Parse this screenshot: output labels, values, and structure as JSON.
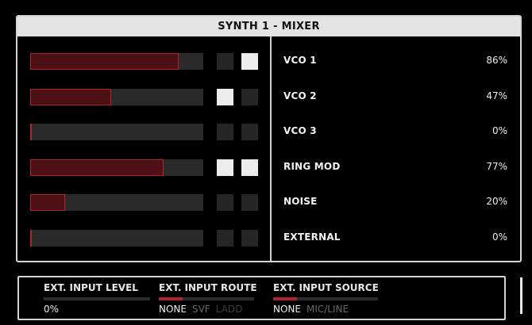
{
  "mixer": {
    "title": "SYNTH 1 - MIXER",
    "channels": [
      {
        "name": "VCO 1",
        "value": "86%",
        "level": 0.86,
        "toggles": [
          false,
          true
        ]
      },
      {
        "name": "VCO 2",
        "value": "47%",
        "level": 0.47,
        "toggles": [
          true,
          false
        ]
      },
      {
        "name": "VCO 3",
        "value": "0%",
        "level": 0.0,
        "toggles": [
          false,
          false
        ]
      },
      {
        "name": "RING MOD",
        "value": "77%",
        "level": 0.77,
        "toggles": [
          true,
          true
        ]
      },
      {
        "name": "NOISE",
        "value": "20%",
        "level": 0.2,
        "toggles": [
          false,
          false
        ]
      },
      {
        "name": "EXTERNAL",
        "value": "0%",
        "level": 0.0,
        "toggles": [
          false,
          false
        ]
      }
    ]
  },
  "ext": {
    "input_level": {
      "label": "EXT. INPUT LEVEL",
      "value": "0%"
    },
    "input_route": {
      "label": "EXT. INPUT ROUTE",
      "options": [
        "NONE",
        "SVF",
        "LADD"
      ],
      "selected": "NONE"
    },
    "input_source": {
      "label": "EXT. INPUT SOURCE",
      "options": [
        "NONE",
        "MIC/LINE"
      ],
      "selected": "NONE"
    }
  },
  "colors": {
    "accent": "#b0242c",
    "fill": "#4d1014",
    "track": "#2a2a2a",
    "on": "#ececec",
    "off": "#262626"
  }
}
